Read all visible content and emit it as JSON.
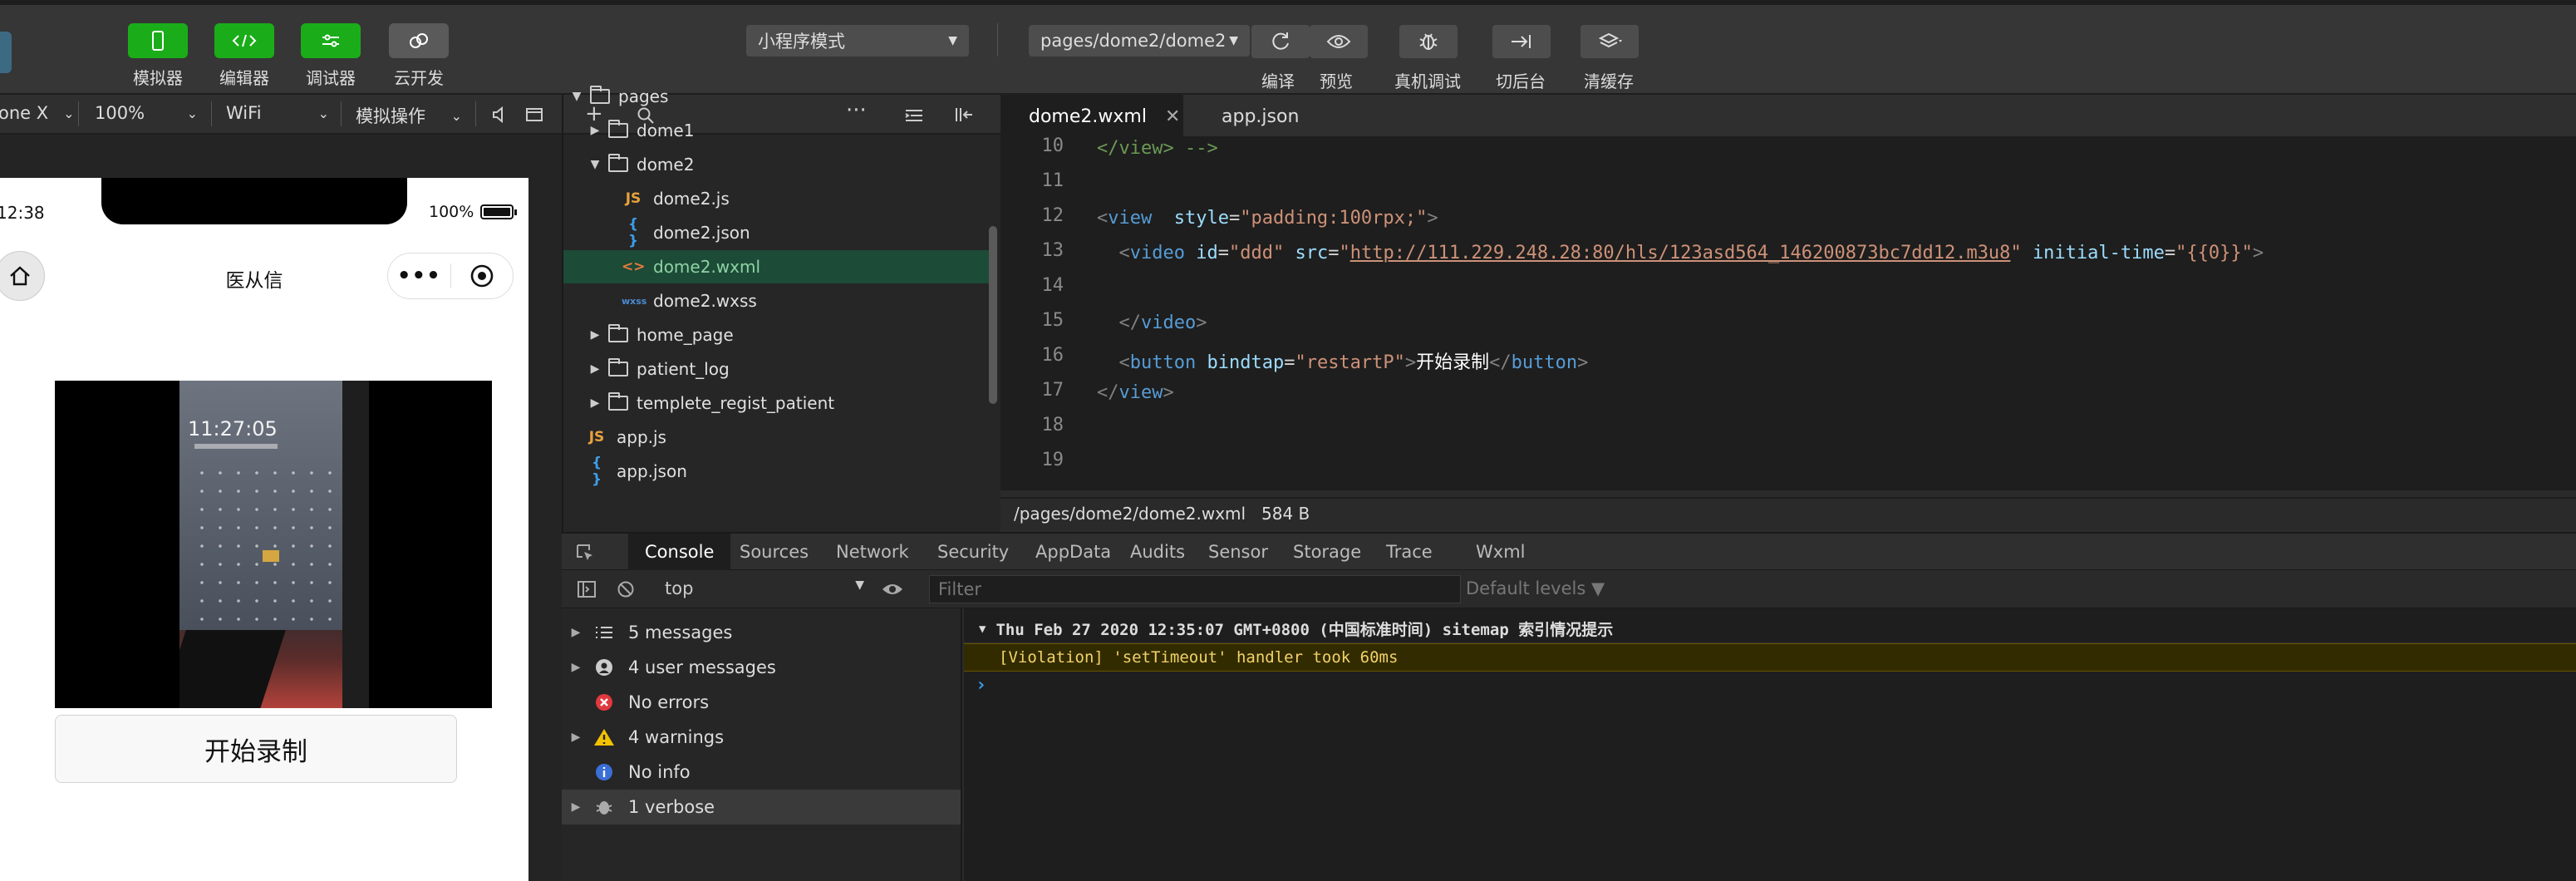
{
  "toolbar": {
    "buttons": [
      {
        "label": "模拟器",
        "icon": "phone-icon"
      },
      {
        "label": "编辑器",
        "icon": "code-icon"
      },
      {
        "label": "调试器",
        "icon": "sliders-icon"
      },
      {
        "label": "云开发",
        "icon": "cloud-icon"
      }
    ],
    "mode_select": "小程序模式",
    "page_select": "pages/dome2/dome2",
    "actions": [
      {
        "label": "编译",
        "icon": "refresh-icon"
      },
      {
        "label": "预览",
        "icon": "eye-icon"
      },
      {
        "label": "真机调试",
        "icon": "bug-icon"
      },
      {
        "label": "切后台",
        "icon": "switch-icon"
      },
      {
        "label": "清缓存",
        "icon": "layers-icon"
      }
    ]
  },
  "subbar": {
    "device": "one X",
    "zoom": "100%",
    "network": "WiFi",
    "operation": "模拟操作"
  },
  "phone": {
    "time": "12:38",
    "battery": "100%",
    "nav_title": "医从信",
    "video_time": "11:27:05",
    "record_button": "开始录制"
  },
  "tree": {
    "items": [
      {
        "name": "pages",
        "type": "folder",
        "open": true,
        "depth": 0
      },
      {
        "name": "dome1",
        "type": "folder",
        "open": false,
        "depth": 1
      },
      {
        "name": "dome2",
        "type": "folder",
        "open": true,
        "depth": 1
      },
      {
        "name": "dome2.js",
        "type": "js",
        "depth": 2
      },
      {
        "name": "dome2.json",
        "type": "json",
        "depth": 2
      },
      {
        "name": "dome2.wxml",
        "type": "wxml",
        "depth": 2,
        "selected": true
      },
      {
        "name": "dome2.wxss",
        "type": "wxss",
        "depth": 2
      },
      {
        "name": "home_page",
        "type": "folder",
        "open": false,
        "depth": 1
      },
      {
        "name": "patient_log",
        "type": "folder",
        "open": false,
        "depth": 1
      },
      {
        "name": "templete_regist_patient",
        "type": "folder",
        "open": false,
        "depth": 1
      },
      {
        "name": "app.js",
        "type": "js",
        "depth": 0
      },
      {
        "name": "app.json",
        "type": "json",
        "depth": 0
      }
    ]
  },
  "editor": {
    "tabs": [
      {
        "label": "dome2.wxml",
        "active": true
      },
      {
        "label": "app.json",
        "active": false
      }
    ],
    "lines": [
      {
        "n": "10",
        "t": "comment",
        "code": "</view> -->"
      },
      {
        "n": "11",
        "t": "blank",
        "code": ""
      },
      {
        "n": "12",
        "t": "view",
        "code": ""
      },
      {
        "n": "13",
        "t": "video",
        "code": ""
      },
      {
        "n": "14",
        "t": "blank",
        "code": ""
      },
      {
        "n": "15",
        "t": "endvideo",
        "code": ""
      },
      {
        "n": "16",
        "t": "button",
        "code": ""
      },
      {
        "n": "17",
        "t": "endview",
        "code": ""
      },
      {
        "n": "18",
        "t": "blank",
        "code": ""
      },
      {
        "n": "19",
        "t": "blank",
        "code": ""
      }
    ],
    "code": {
      "view_style": "\"padding:100rpx;\"",
      "video_id": "\"ddd\"",
      "video_src": "http://111.229.248.28:80/hls/123asd564_146200873bc7dd12.m3u8",
      "video_time": "\"{{0}}\"",
      "button_bind": "\"restartP\"",
      "button_text": "开始录制"
    },
    "status_path": "/pages/dome2/dome2.wxml",
    "status_size": "584 B"
  },
  "devtools": {
    "tabs": [
      "Console",
      "Sources",
      "Network",
      "Security",
      "AppData",
      "Audits",
      "Sensor",
      "Storage",
      "Trace",
      "Wxml"
    ],
    "context": "top",
    "filter_placeholder": "Filter",
    "levels": "Default levels ▼",
    "side": [
      {
        "label": "5 messages",
        "icon": "list-icon",
        "expandable": true
      },
      {
        "label": "4 user messages",
        "icon": "user-icon",
        "expandable": true
      },
      {
        "label": "No errors",
        "icon": "error-icon",
        "expandable": false
      },
      {
        "label": "4 warnings",
        "icon": "warning-icon",
        "expandable": true
      },
      {
        "label": "No info",
        "icon": "info-icon",
        "expandable": false
      },
      {
        "label": "1 verbose",
        "icon": "verbose-icon",
        "expandable": true,
        "selected": true
      }
    ],
    "log1": "Thu Feb 27 2020 12:35:07 GMT+0800 (中国标准时间) sitemap 索引情况提示",
    "log2": "[Violation] 'setTimeout' handler took 60ms"
  },
  "colors": {
    "accent": "#1aad19",
    "selection": "#1c4b37",
    "warning_bg": "#332b00"
  }
}
